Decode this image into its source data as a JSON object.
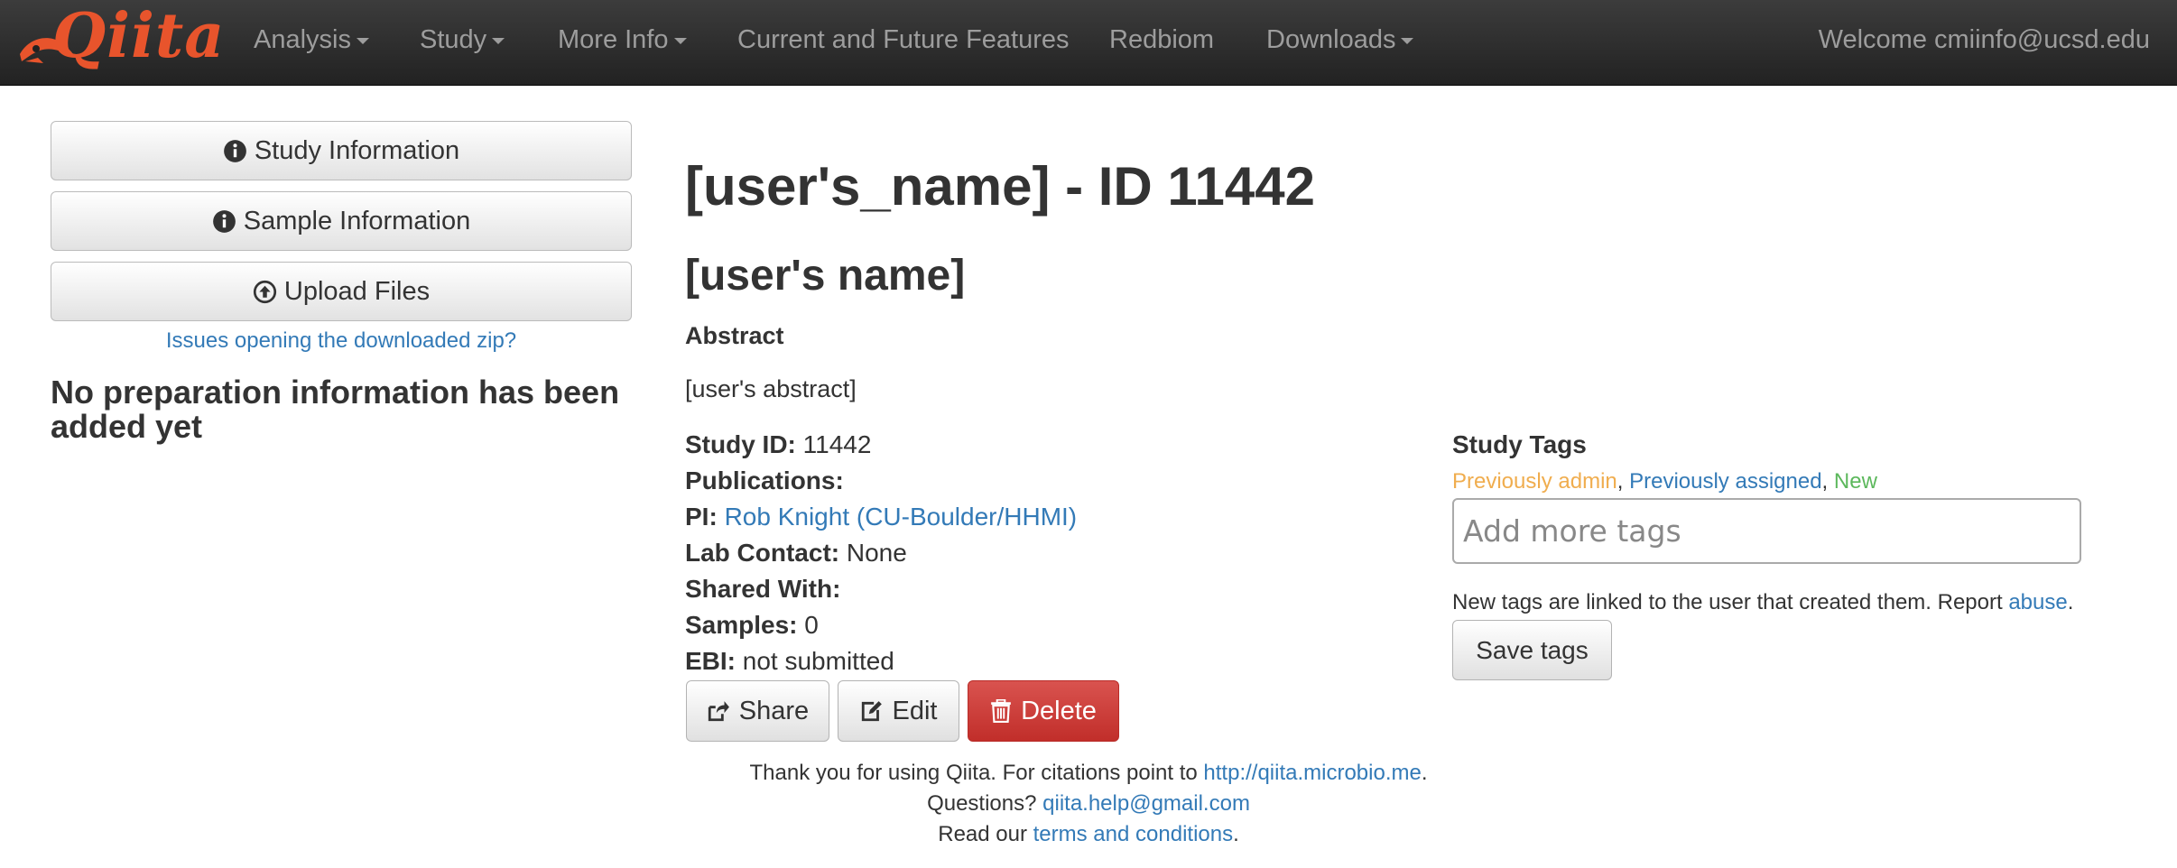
{
  "navbar": {
    "logo": "Qiita",
    "items": [
      "Analysis",
      "Study",
      "More Info",
      "Current and Future Features",
      "Redbiom",
      "Downloads"
    ],
    "welcome": "Welcome cmiinfo@ucsd.edu"
  },
  "sidebar": {
    "buttons": [
      "Study Information",
      "Sample Information",
      "Upload Files"
    ],
    "zip_link": "Issues opening the downloaded zip?",
    "no_prep": "No preparation information has been added yet"
  },
  "study": {
    "heading": "[user's_name] - ID 11442",
    "subheading": "[user's name]",
    "abstract_label": "Abstract",
    "abstract": "[user's abstract]",
    "study_id_label": "Study ID:",
    "study_id": "11442",
    "publications_label": "Publications:",
    "pi_label": "PI:",
    "pi": "Rob Knight (CU-Boulder/HHMI)",
    "lab_contact_label": "Lab Contact:",
    "lab_contact": "None",
    "shared_with_label": "Shared With:",
    "samples_label": "Samples:",
    "samples": "0",
    "ebi_label": "EBI:",
    "ebi": "not submitted"
  },
  "actions": {
    "share": "Share",
    "edit": "Edit",
    "delete": "Delete"
  },
  "tags": {
    "title": "Study Tags",
    "legend_admin": "Previously admin",
    "legend_assigned": "Previously assigned",
    "legend_new": "New",
    "input_placeholder": "Add more tags",
    "note": "New tags are linked to the user that created them. Report ",
    "abuse_link": "abuse",
    "save": "Save tags"
  },
  "footer": {
    "thanks": "Thank you for using Qiita. For citations point to ",
    "url": "http://qiita.microbio.me",
    "questions": "Questions? ",
    "email": "qiita.help@gmail.com",
    "read": "Read our ",
    "terms": "terms and conditions"
  },
  "colors": {
    "accent": "#337ab7",
    "danger": "#d9534f",
    "brand": "#e8542c",
    "admin_tag": "#f0ad4e",
    "new_tag": "#5cb85c"
  }
}
